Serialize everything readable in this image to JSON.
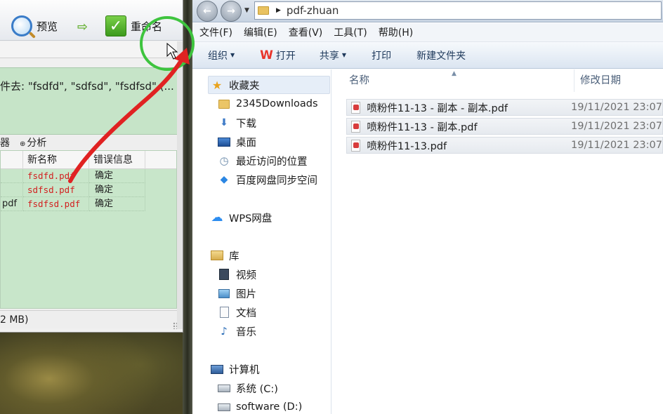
{
  "renamer": {
    "preview_label": "预览",
    "rename_label": "重命名",
    "hint_text": "件去: \"fsdfd\", \"sdfsd\", \"fsdfsd\" (...",
    "tabs": [
      "器",
      "分析"
    ],
    "columns": [
      "",
      "新名称",
      "错误信息"
    ],
    "rows": [
      {
        "old": "",
        "new": "fsdfd.pdf",
        "error": "确定"
      },
      {
        "old": "",
        "new": "sdfsd.pdf",
        "error": "确定"
      },
      {
        "old": "pdf",
        "new": "fsdfsd.pdf",
        "error": "确定"
      }
    ],
    "status": "2 MB)"
  },
  "explorer": {
    "path": "pdf-zhuan",
    "menu": [
      "文件(F)",
      "编辑(E)",
      "查看(V)",
      "工具(T)",
      "帮助(H)"
    ],
    "commands": {
      "organize": "组织",
      "open": "打开",
      "share": "共享",
      "print": "打印",
      "new_folder": "新建文件夹"
    },
    "nav": {
      "favorites": "收藏夹",
      "fav_items": [
        "2345Downloads",
        "下载",
        "桌面",
        "最近访问的位置",
        "百度网盘同步空间"
      ],
      "wps": "WPS网盘",
      "library": "库",
      "lib_items": [
        "视频",
        "图片",
        "文档",
        "音乐"
      ],
      "computer": "计算机",
      "drives": [
        "系统 (C:)",
        "software (D:)"
      ]
    },
    "columns": {
      "name": "名称",
      "date": "修改日期"
    },
    "files": [
      {
        "name": "喷粉件11-13 - 副本 - 副本.pdf",
        "date": "19/11/2021 23:07"
      },
      {
        "name": "喷粉件11-13 - 副本.pdf",
        "date": "19/11/2021 23:07"
      },
      {
        "name": "喷粉件11-13.pdf",
        "date": "19/11/2021 23:07"
      }
    ]
  },
  "annotation": {
    "circle_color": "#3ec43e",
    "arrow_color": "#e02222"
  }
}
